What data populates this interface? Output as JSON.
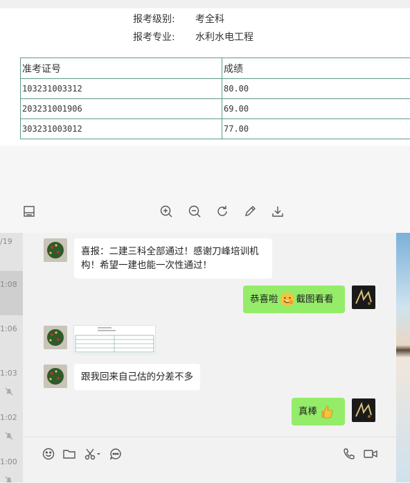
{
  "document": {
    "level_label": "报考级别:",
    "level_value": "考全科",
    "major_label": "报考专业:",
    "major_value": "水利水电工程",
    "table": {
      "headers": [
        "准考证号",
        "成绩"
      ],
      "rows": [
        [
          "103231003312",
          "80.00"
        ],
        [
          "203231001906",
          "69.00"
        ],
        [
          "303231003012",
          "77.00"
        ]
      ]
    }
  },
  "viewer_toolbar": [
    "panel-toggle-icon",
    "zoom-in-icon",
    "zoom-out-icon",
    "rotate-icon",
    "edit-icon",
    "download-icon"
  ],
  "sidebar": {
    "time_fragments": [
      "/19",
      "1:08",
      "1:06",
      "1:03",
      "1:02",
      "1:00"
    ]
  },
  "messages": [
    {
      "side": "in",
      "text": "喜报：二建三科全部通过！感谢刀峰培训机构！希望一建也能一次性通过！",
      "line1": "喜报：二建三科全部通过！感谢刀峰培训机",
      "line2": "构！希望一建也能一次性通过！"
    },
    {
      "side": "out",
      "text_before": "恭喜啦",
      "emoji": "grin-emoji",
      "text_after": "截图看看"
    },
    {
      "side": "in",
      "type": "image",
      "image": "score-screenshot-thumbnail"
    },
    {
      "side": "in",
      "text": "跟我回来自己估的分差不多"
    },
    {
      "side": "out",
      "text_before": "真棒",
      "emoji": "thumbs-up-emoji"
    }
  ],
  "input_toolbar": [
    "emoji-icon",
    "folder-icon",
    "scissors-icon",
    "chat-history-icon",
    "phone-icon",
    "video-icon"
  ],
  "colors": {
    "outgoing_bubble": "#95ec69",
    "incoming_bubble": "#ffffff",
    "table_border": "#5b9a8a"
  }
}
